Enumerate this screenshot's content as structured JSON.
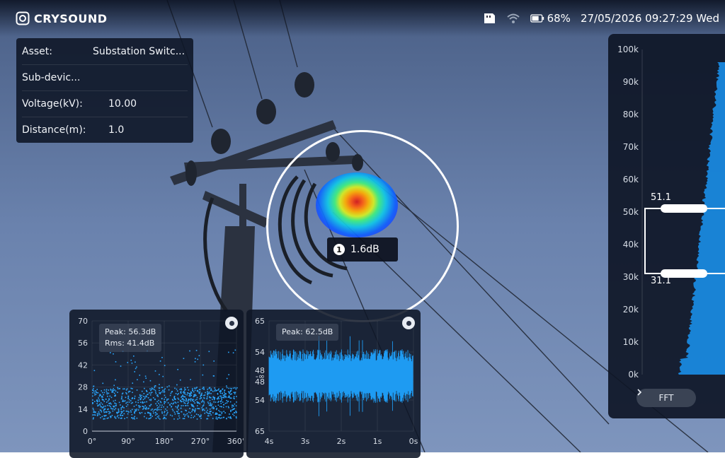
{
  "status": {
    "brand": "CRYSOUND",
    "battery": "68%",
    "datetime": "27/05/2026 09:27:29 Wed",
    "icons": [
      "crysound-logo-icon",
      "sd-card-icon",
      "wifi-icon",
      "battery-icon"
    ]
  },
  "asset": {
    "rows": [
      {
        "key": "Asset:",
        "value": "Substation Switc..."
      },
      {
        "key": "Sub-devic...",
        "value": ""
      },
      {
        "key": "Voltage(kV):",
        "value": "10.00"
      },
      {
        "key": "Distance(m):",
        "value": "1.0"
      }
    ]
  },
  "hotspot": {
    "index": "1",
    "value": "1.6dB"
  },
  "phase_chart": {
    "peak": "Peak: 56.3dB",
    "rms": "Rms: 41.4dB",
    "point_color": "#2aa7ff"
  },
  "time_chart": {
    "peak": "Peak: 62.5dB",
    "wave_color": "#1e9bf2"
  },
  "fft": {
    "button_label": "FFT",
    "band_upper": "51.1",
    "band_lower": "31.1",
    "fill_color": "#1a8ee8"
  },
  "chart_data": [
    {
      "type": "scatter",
      "x_ticks": [
        "0°",
        "90°",
        "180°",
        "270°",
        "360°"
      ],
      "y_ticks": [
        "70",
        "56",
        "42",
        "28",
        "14",
        "0"
      ],
      "xlim": [
        0,
        360
      ],
      "ylim": [
        0,
        70
      ],
      "grid": true,
      "points_summary": {
        "dense_band": [
          8,
          28
        ],
        "sparse_upper": [
          28,
          56
        ]
      }
    },
    {
      "type": "area",
      "x_ticks": [
        "4s",
        "3s",
        "2s",
        "1s",
        "0s"
      ],
      "y_ticks": [
        "65",
        "54",
        "48",
        "-∞",
        "48",
        "54",
        "65"
      ],
      "xlim": [
        4,
        0
      ],
      "grid": true,
      "envelope_db": {
        "typical": 51,
        "max": 62.5
      }
    },
    {
      "type": "area",
      "y_ticks": [
        "100k",
        "90k",
        "80k",
        "70k",
        "60k",
        "50k",
        "40k",
        "30k",
        "20k",
        "10k",
        "0k"
      ],
      "ylim": [
        0,
        100000
      ],
      "band": [
        31100,
        51100
      ],
      "grid": false
    }
  ]
}
